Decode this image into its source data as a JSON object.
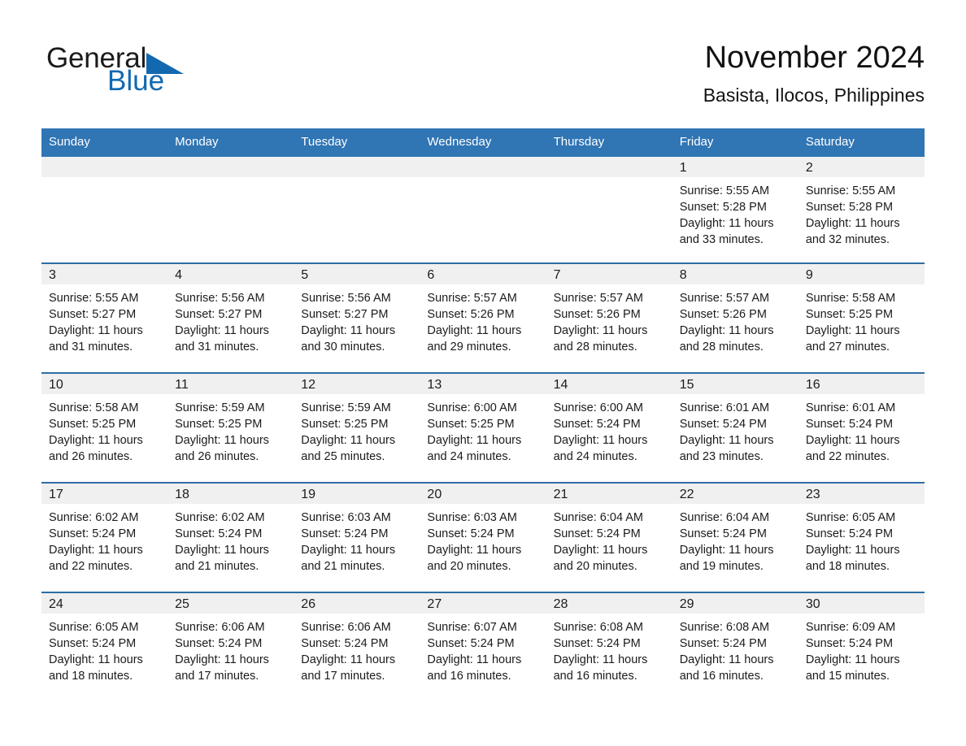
{
  "brand": {
    "name_part1": "General",
    "name_part2": "Blue",
    "triangle_color": "#1269b0"
  },
  "header": {
    "title": "November 2024",
    "location": "Basista, Ilocos, Philippines"
  },
  "theme": {
    "header_blue": "#3075b4",
    "row_rule_blue": "#2e6da4",
    "daynum_strip": "#f0f0f0",
    "text": "#1b1b1b",
    "brand_blue": "#1269b0"
  },
  "calendar": {
    "weekday_headers": [
      "Sunday",
      "Monday",
      "Tuesday",
      "Wednesday",
      "Thursday",
      "Friday",
      "Saturday"
    ],
    "weeks": [
      [
        {
          "day": ""
        },
        {
          "day": ""
        },
        {
          "day": ""
        },
        {
          "day": ""
        },
        {
          "day": ""
        },
        {
          "day": "1",
          "sunrise": "Sunrise: 5:55 AM",
          "sunset": "Sunset: 5:28 PM",
          "daylight": "Daylight: 11 hours and 33 minutes."
        },
        {
          "day": "2",
          "sunrise": "Sunrise: 5:55 AM",
          "sunset": "Sunset: 5:28 PM",
          "daylight": "Daylight: 11 hours and 32 minutes."
        }
      ],
      [
        {
          "day": "3",
          "sunrise": "Sunrise: 5:55 AM",
          "sunset": "Sunset: 5:27 PM",
          "daylight": "Daylight: 11 hours and 31 minutes."
        },
        {
          "day": "4",
          "sunrise": "Sunrise: 5:56 AM",
          "sunset": "Sunset: 5:27 PM",
          "daylight": "Daylight: 11 hours and 31 minutes."
        },
        {
          "day": "5",
          "sunrise": "Sunrise: 5:56 AM",
          "sunset": "Sunset: 5:27 PM",
          "daylight": "Daylight: 11 hours and 30 minutes."
        },
        {
          "day": "6",
          "sunrise": "Sunrise: 5:57 AM",
          "sunset": "Sunset: 5:26 PM",
          "daylight": "Daylight: 11 hours and 29 minutes."
        },
        {
          "day": "7",
          "sunrise": "Sunrise: 5:57 AM",
          "sunset": "Sunset: 5:26 PM",
          "daylight": "Daylight: 11 hours and 28 minutes."
        },
        {
          "day": "8",
          "sunrise": "Sunrise: 5:57 AM",
          "sunset": "Sunset: 5:26 PM",
          "daylight": "Daylight: 11 hours and 28 minutes."
        },
        {
          "day": "9",
          "sunrise": "Sunrise: 5:58 AM",
          "sunset": "Sunset: 5:25 PM",
          "daylight": "Daylight: 11 hours and 27 minutes."
        }
      ],
      [
        {
          "day": "10",
          "sunrise": "Sunrise: 5:58 AM",
          "sunset": "Sunset: 5:25 PM",
          "daylight": "Daylight: 11 hours and 26 minutes."
        },
        {
          "day": "11",
          "sunrise": "Sunrise: 5:59 AM",
          "sunset": "Sunset: 5:25 PM",
          "daylight": "Daylight: 11 hours and 26 minutes."
        },
        {
          "day": "12",
          "sunrise": "Sunrise: 5:59 AM",
          "sunset": "Sunset: 5:25 PM",
          "daylight": "Daylight: 11 hours and 25 minutes."
        },
        {
          "day": "13",
          "sunrise": "Sunrise: 6:00 AM",
          "sunset": "Sunset: 5:25 PM",
          "daylight": "Daylight: 11 hours and 24 minutes."
        },
        {
          "day": "14",
          "sunrise": "Sunrise: 6:00 AM",
          "sunset": "Sunset: 5:24 PM",
          "daylight": "Daylight: 11 hours and 24 minutes."
        },
        {
          "day": "15",
          "sunrise": "Sunrise: 6:01 AM",
          "sunset": "Sunset: 5:24 PM",
          "daylight": "Daylight: 11 hours and 23 minutes."
        },
        {
          "day": "16",
          "sunrise": "Sunrise: 6:01 AM",
          "sunset": "Sunset: 5:24 PM",
          "daylight": "Daylight: 11 hours and 22 minutes."
        }
      ],
      [
        {
          "day": "17",
          "sunrise": "Sunrise: 6:02 AM",
          "sunset": "Sunset: 5:24 PM",
          "daylight": "Daylight: 11 hours and 22 minutes."
        },
        {
          "day": "18",
          "sunrise": "Sunrise: 6:02 AM",
          "sunset": "Sunset: 5:24 PM",
          "daylight": "Daylight: 11 hours and 21 minutes."
        },
        {
          "day": "19",
          "sunrise": "Sunrise: 6:03 AM",
          "sunset": "Sunset: 5:24 PM",
          "daylight": "Daylight: 11 hours and 21 minutes."
        },
        {
          "day": "20",
          "sunrise": "Sunrise: 6:03 AM",
          "sunset": "Sunset: 5:24 PM",
          "daylight": "Daylight: 11 hours and 20 minutes."
        },
        {
          "day": "21",
          "sunrise": "Sunrise: 6:04 AM",
          "sunset": "Sunset: 5:24 PM",
          "daylight": "Daylight: 11 hours and 20 minutes."
        },
        {
          "day": "22",
          "sunrise": "Sunrise: 6:04 AM",
          "sunset": "Sunset: 5:24 PM",
          "daylight": "Daylight: 11 hours and 19 minutes."
        },
        {
          "day": "23",
          "sunrise": "Sunrise: 6:05 AM",
          "sunset": "Sunset: 5:24 PM",
          "daylight": "Daylight: 11 hours and 18 minutes."
        }
      ],
      [
        {
          "day": "24",
          "sunrise": "Sunrise: 6:05 AM",
          "sunset": "Sunset: 5:24 PM",
          "daylight": "Daylight: 11 hours and 18 minutes."
        },
        {
          "day": "25",
          "sunrise": "Sunrise: 6:06 AM",
          "sunset": "Sunset: 5:24 PM",
          "daylight": "Daylight: 11 hours and 17 minutes."
        },
        {
          "day": "26",
          "sunrise": "Sunrise: 6:06 AM",
          "sunset": "Sunset: 5:24 PM",
          "daylight": "Daylight: 11 hours and 17 minutes."
        },
        {
          "day": "27",
          "sunrise": "Sunrise: 6:07 AM",
          "sunset": "Sunset: 5:24 PM",
          "daylight": "Daylight: 11 hours and 16 minutes."
        },
        {
          "day": "28",
          "sunrise": "Sunrise: 6:08 AM",
          "sunset": "Sunset: 5:24 PM",
          "daylight": "Daylight: 11 hours and 16 minutes."
        },
        {
          "day": "29",
          "sunrise": "Sunrise: 6:08 AM",
          "sunset": "Sunset: 5:24 PM",
          "daylight": "Daylight: 11 hours and 16 minutes."
        },
        {
          "day": "30",
          "sunrise": "Sunrise: 6:09 AM",
          "sunset": "Sunset: 5:24 PM",
          "daylight": "Daylight: 11 hours and 15 minutes."
        }
      ]
    ]
  }
}
